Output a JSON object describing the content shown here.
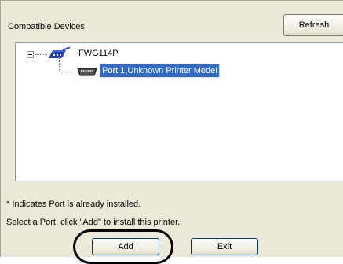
{
  "header": {
    "label": "Compatible Devices",
    "refresh_label": "Refresh"
  },
  "tree": {
    "root": {
      "label": "FWG114P",
      "expander": "minus",
      "icon": "router-icon"
    },
    "port": {
      "label": "Port 1,Unknown Printer Model",
      "icon": "printer-port-icon",
      "selected": true
    }
  },
  "notes": {
    "installed": "* Indicates Port is already installed.",
    "instruction": "Select a Port, click \"Add\" to install this printer."
  },
  "buttons": {
    "add_label": "Add",
    "exit_label": "Exit"
  },
  "colors": {
    "selection": "#316ac5",
    "dialog_bg": "#ece9d8",
    "router_blue": "#1f3fb0"
  }
}
